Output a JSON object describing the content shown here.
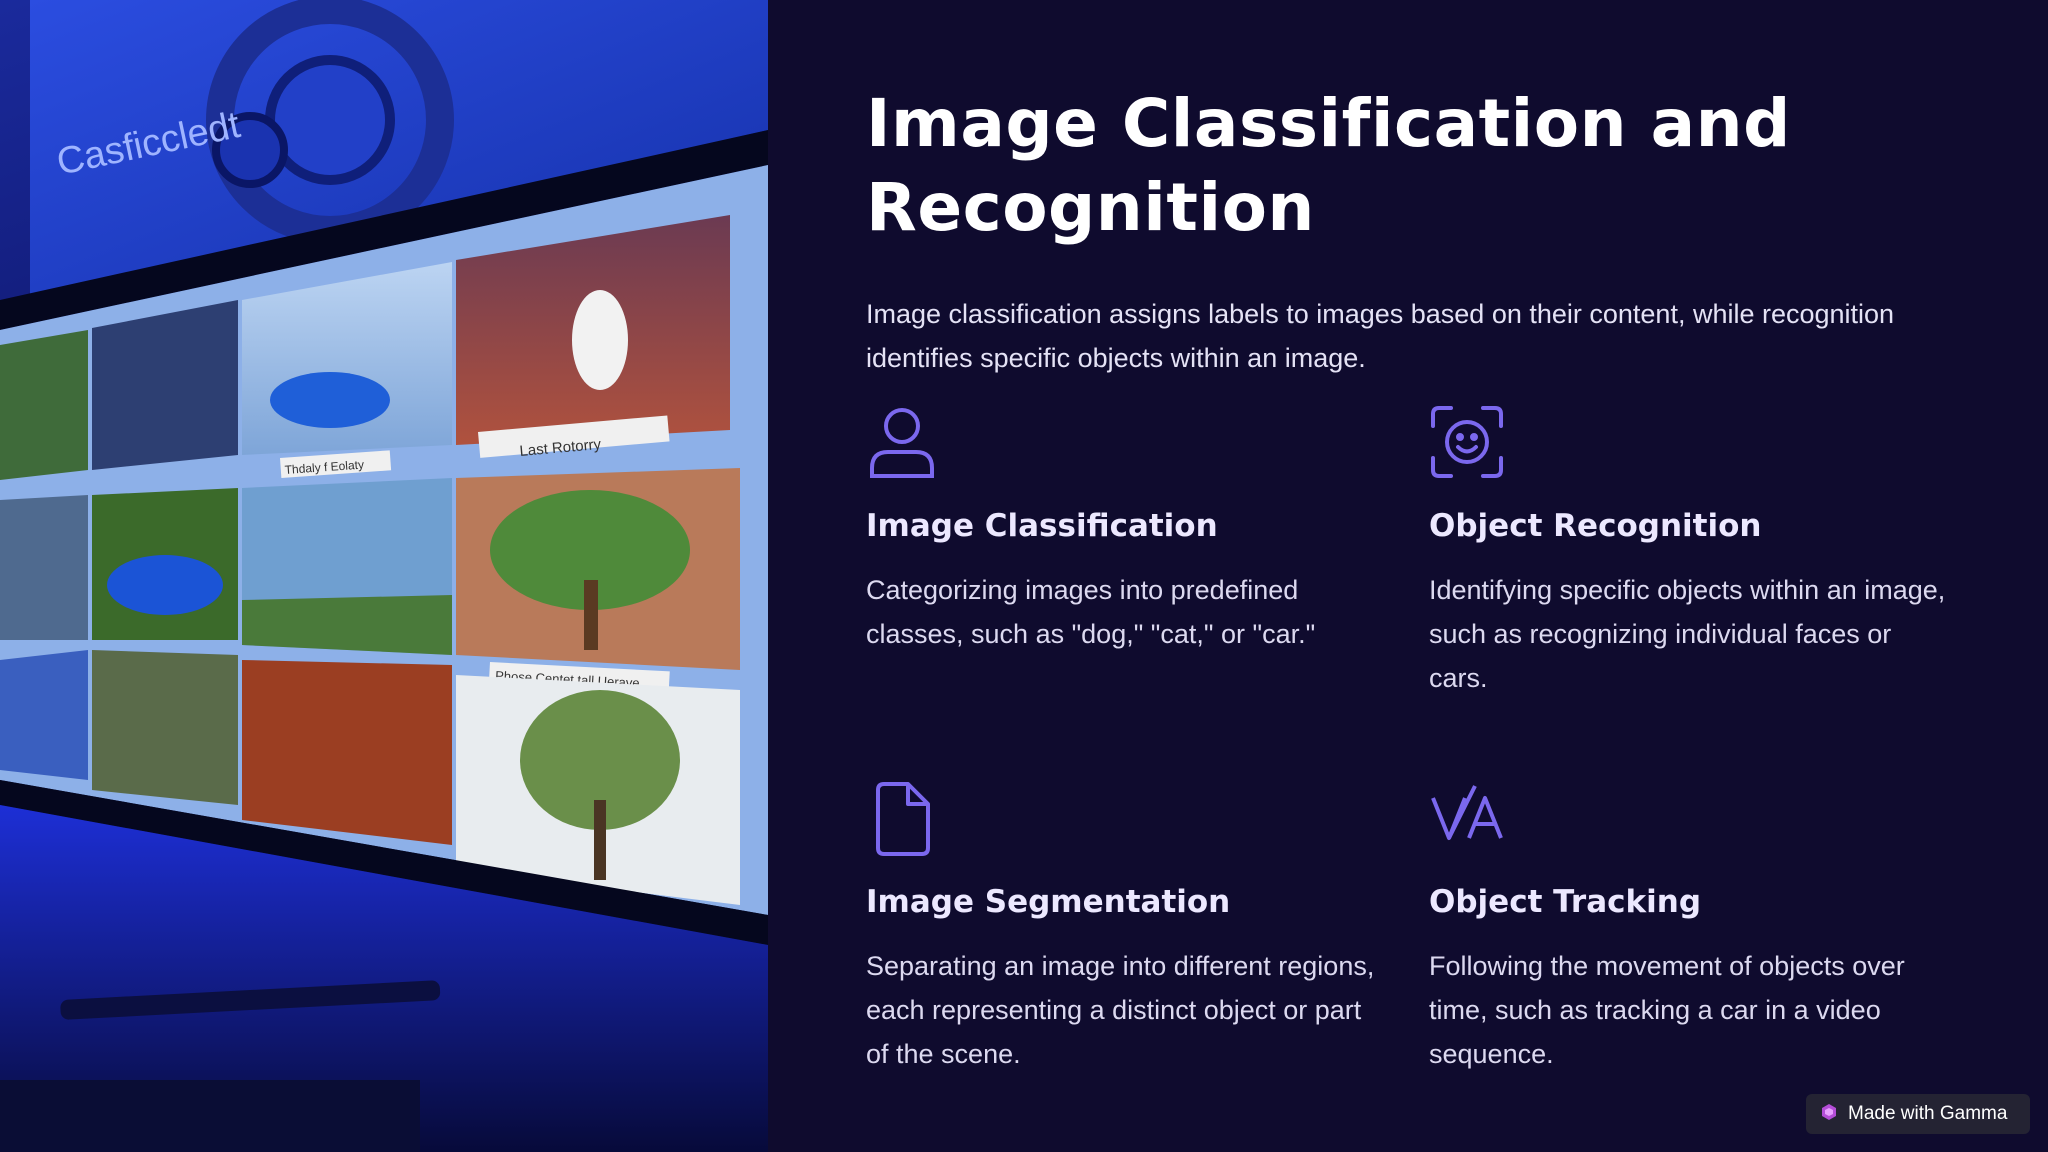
{
  "slide": {
    "title": "Image Classification and Recognition",
    "intro": "Image classification assigns labels to images based on their content, while recognition identifies specific objects within an image."
  },
  "cards": [
    {
      "icon": "person-icon",
      "title": "Image Classification",
      "text": "Categorizing images into predefined classes, such as \"dog,\" \"cat,\" or \"car.\""
    },
    {
      "icon": "face-scan-icon",
      "title": "Object Recognition",
      "text": "Identifying specific objects within an image, such as recognizing individual faces or cars."
    },
    {
      "icon": "document-icon",
      "title": "Image Segmentation",
      "text": "Separating an image into different regions, each representing a distinct object or part of the scene."
    },
    {
      "icon": "va-letters-icon",
      "title": "Object Tracking",
      "text": "Following the movement of objects over time, such as tracking a car in a video sequence."
    }
  ],
  "badge": {
    "label": "Made with Gamma"
  },
  "hero_image": {
    "screen_text": "Casficcledt",
    "photo_labels": [
      "Last Rotorry",
      "Thdaly f Eolaty",
      "Phose Centet tall Uerave"
    ]
  },
  "colors": {
    "background": "#0f0b2e",
    "accent": "#7b68ee",
    "heading": "#ffffff",
    "body_text": "#dcd9f0"
  }
}
